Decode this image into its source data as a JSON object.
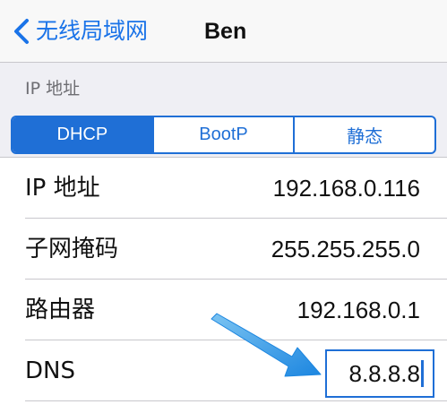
{
  "nav": {
    "back_label": "无线局域网",
    "title": "Ben"
  },
  "section": {
    "header": "IP 地址"
  },
  "segments": [
    {
      "label": "DHCP",
      "selected": true
    },
    {
      "label": "BootP",
      "selected": false
    },
    {
      "label": "静态",
      "selected": false
    }
  ],
  "rows": [
    {
      "label": "IP 地址",
      "value": "192.168.0.116"
    },
    {
      "label": "子网掩码",
      "value": "255.255.255.0"
    },
    {
      "label": "路由器",
      "value": "192.168.0.1"
    },
    {
      "label": "DNS",
      "value": "8.8.8.8"
    }
  ],
  "colors": {
    "accent": "#1f6fd6",
    "annotation_arrow": "#3a9be8"
  }
}
